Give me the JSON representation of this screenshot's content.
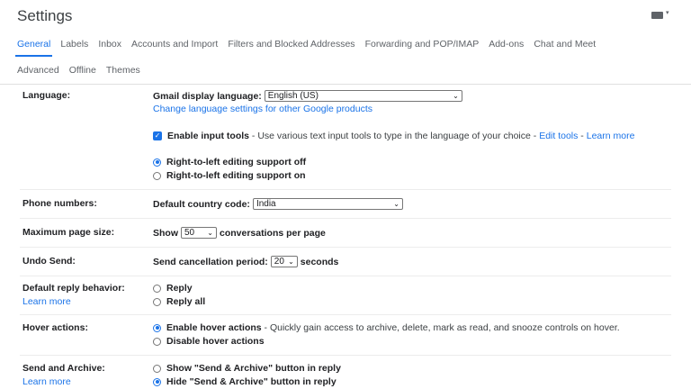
{
  "title": "Settings",
  "header": {
    "keyboard_icon": "keyboard-icon",
    "caret": "▾"
  },
  "tabs_row1": [
    "General",
    "Labels",
    "Inbox",
    "Accounts and Import",
    "Filters and Blocked Addresses",
    "Forwarding and POP/IMAP",
    "Add-ons",
    "Chat and Meet"
  ],
  "tabs_row2": [
    "Advanced",
    "Offline",
    "Themes"
  ],
  "active_tab": "General",
  "language": {
    "label": "Language:",
    "display_label": "Gmail display language:",
    "display_value": "English (US)",
    "change_link": "Change language settings for other Google products",
    "input_tools_label": "Enable input tools",
    "input_tools_desc": " - Use various text input tools to type in the language of your choice - ",
    "edit_tools": "Edit tools",
    "dash": " - ",
    "learn_more": "Learn more",
    "rtl_off": "Right-to-left editing support off",
    "rtl_on": "Right-to-left editing support on"
  },
  "phone": {
    "label": "Phone numbers:",
    "code_label": "Default country code:",
    "code_value": "India"
  },
  "page_size": {
    "label": "Maximum page size:",
    "show": "Show",
    "value": "50",
    "suffix": "conversations per page"
  },
  "undo_send": {
    "label": "Undo Send:",
    "period_label": "Send cancellation period:",
    "value": "20",
    "suffix": "seconds"
  },
  "reply": {
    "label": "Default reply behavior:",
    "learn_more": "Learn more",
    "opt1": "Reply",
    "opt2": "Reply all"
  },
  "hover": {
    "label": "Hover actions:",
    "opt1": "Enable hover actions",
    "opt1_desc": " - Quickly gain access to archive, delete, mark as read, and snooze controls on hover.",
    "opt2": "Disable hover actions"
  },
  "send_archive": {
    "label": "Send and Archive:",
    "learn_more": "Learn more",
    "opt1": "Show \"Send & Archive\" button in reply",
    "opt2": "Hide \"Send & Archive\" button in reply"
  },
  "colors": {
    "accent": "#1a73e8",
    "text": "#202124",
    "muted": "#5f6368"
  }
}
